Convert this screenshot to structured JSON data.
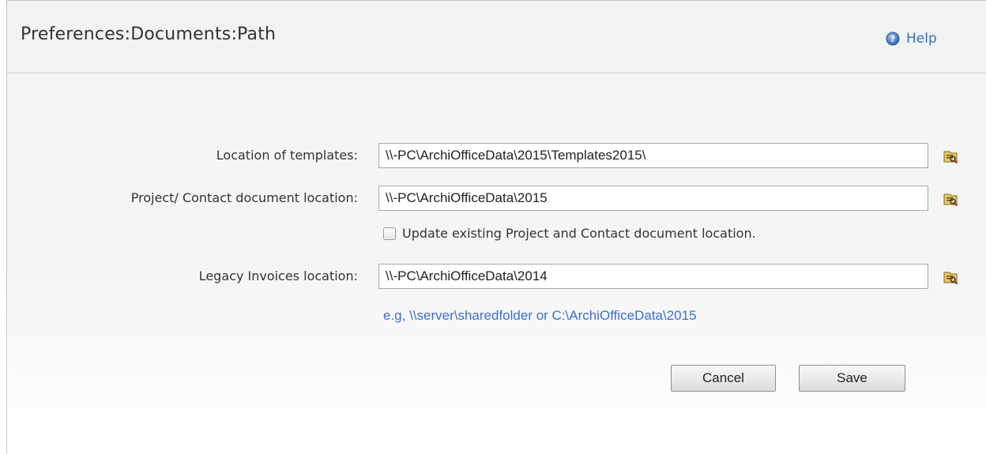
{
  "header": {
    "title": "Preferences:Documents:Path",
    "help_label": "Help",
    "help_icon": "help-icon"
  },
  "form": {
    "templates": {
      "label": "Location of templates:",
      "value": "\\\\-PC\\ArchiOfficeData\\2015\\Templates2015\\",
      "browse_icon": "browse-folder-icon"
    },
    "project_contact": {
      "label": "Project/ Contact document location:",
      "value": "\\\\-PC\\ArchiOfficeData\\2015",
      "browse_icon": "browse-folder-icon"
    },
    "update_existing": {
      "label": "Update existing Project and Contact document location.",
      "checked": false
    },
    "legacy_invoices": {
      "label": "Legacy Invoices location:",
      "value": "\\\\-PC\\ArchiOfficeData\\2014",
      "browse_icon": "browse-folder-icon"
    },
    "example_hint": "e.g, \\\\server\\sharedfolder or C:\\ArchiOfficeData\\2015"
  },
  "actions": {
    "cancel_label": "Cancel",
    "save_label": "Save"
  },
  "colors": {
    "link": "#3a6fb7",
    "hint": "#3a6fd0",
    "header_bg": "#f2f2f2",
    "panel_bg": "#f5f5f5"
  }
}
